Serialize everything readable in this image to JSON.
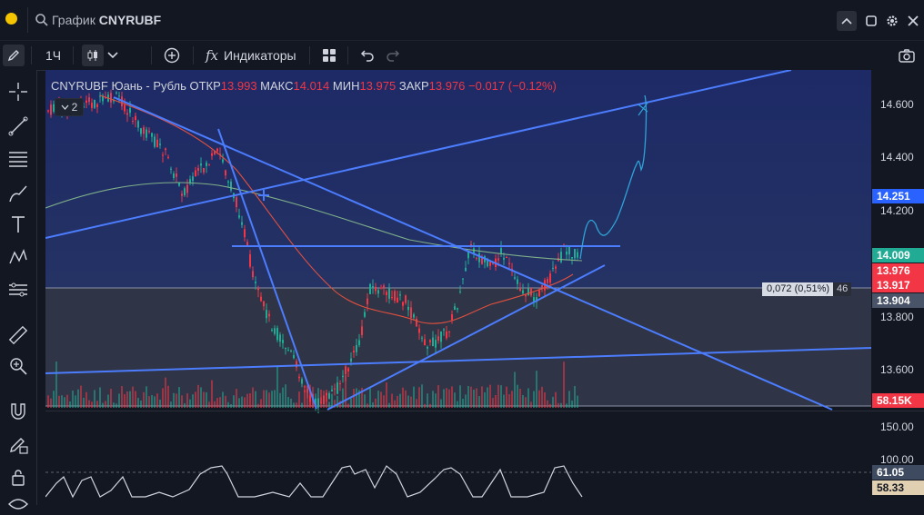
{
  "titlebar": {
    "prefix": "График",
    "symbol": "CNYRUBF"
  },
  "toolbar": {
    "interval": "1Ч",
    "indicators": "Индикаторы"
  },
  "legend": {
    "name": "CNYRUBF Юань - Рубль",
    "open_label": "ОТКР",
    "open": "13.993",
    "high_label": "МАКС",
    "high": "14.014",
    "low_label": "МИН",
    "low": "13.975",
    "close_label": "ЗАКР",
    "close": "13.976",
    "change": "−0.017 (−0.12%)",
    "collapse_count": "2"
  },
  "measure": {
    "value": "0,072 (0,51%)",
    "bars": "46"
  },
  "price_axis": {
    "ticks": [
      "14.600",
      "14.400",
      "14.200",
      "13.800",
      "13.600"
    ],
    "badges": [
      {
        "text": "14.251",
        "color": "#2962ff"
      },
      {
        "text": "14.009",
        "color": "#22ab94"
      },
      {
        "text": "13.976",
        "color": "#f23645"
      },
      {
        "text": "13.917",
        "color": "#f23645"
      },
      {
        "text": "13.904",
        "color": "#4a5468"
      },
      {
        "text": "58.15K",
        "color": "#f23645"
      }
    ]
  },
  "oscillator_axis": {
    "ticks": [
      "150.00",
      "100.00"
    ],
    "badges": [
      {
        "text": "61.05",
        "color": "#3e4a5f"
      },
      {
        "text": "58.33",
        "color": "#e0cfb1"
      }
    ]
  },
  "colors": {
    "accent": "#2962ff",
    "up": "#22ab94",
    "down": "#f23645",
    "drawing": "#4c7dff"
  }
}
